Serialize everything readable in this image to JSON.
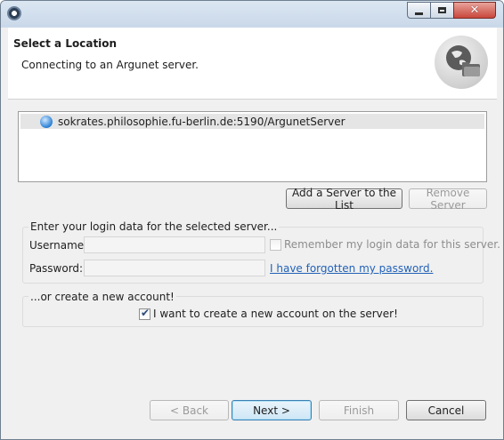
{
  "window": {
    "title": "",
    "controls": {
      "minimize": "minimize-icon",
      "maximize": "maximize-icon",
      "close": "close-icon"
    }
  },
  "header": {
    "title": "Select a Location",
    "description": "Connecting to an Argunet server.",
    "icon": "globe-folder-icon"
  },
  "servers": [
    {
      "label": "sokrates.philosophie.fu-berlin.de:5190/ArgunetServer",
      "selected": true
    }
  ],
  "server_buttons": {
    "add": "Add a Server to the List",
    "remove": "Remove Server"
  },
  "login": {
    "legend": "Enter your login data for the selected server...",
    "username_label": "Username:",
    "username_value": "",
    "password_label": "Password:",
    "password_value": "",
    "remember_label": "Remember my login data for this server.",
    "remember_checked": false,
    "forgot_link": "I have forgotten my password."
  },
  "new_account": {
    "legend": "...or create a new account!",
    "checkbox_label": "I want to create a new account on the server!",
    "checked": true
  },
  "footer": {
    "back": "< Back",
    "next": "Next >",
    "finish": "Finish",
    "cancel": "Cancel"
  },
  "colors": {
    "link": "#2262b8",
    "default_button_border": "#3c7fb1",
    "close_button": "#c9473c"
  }
}
